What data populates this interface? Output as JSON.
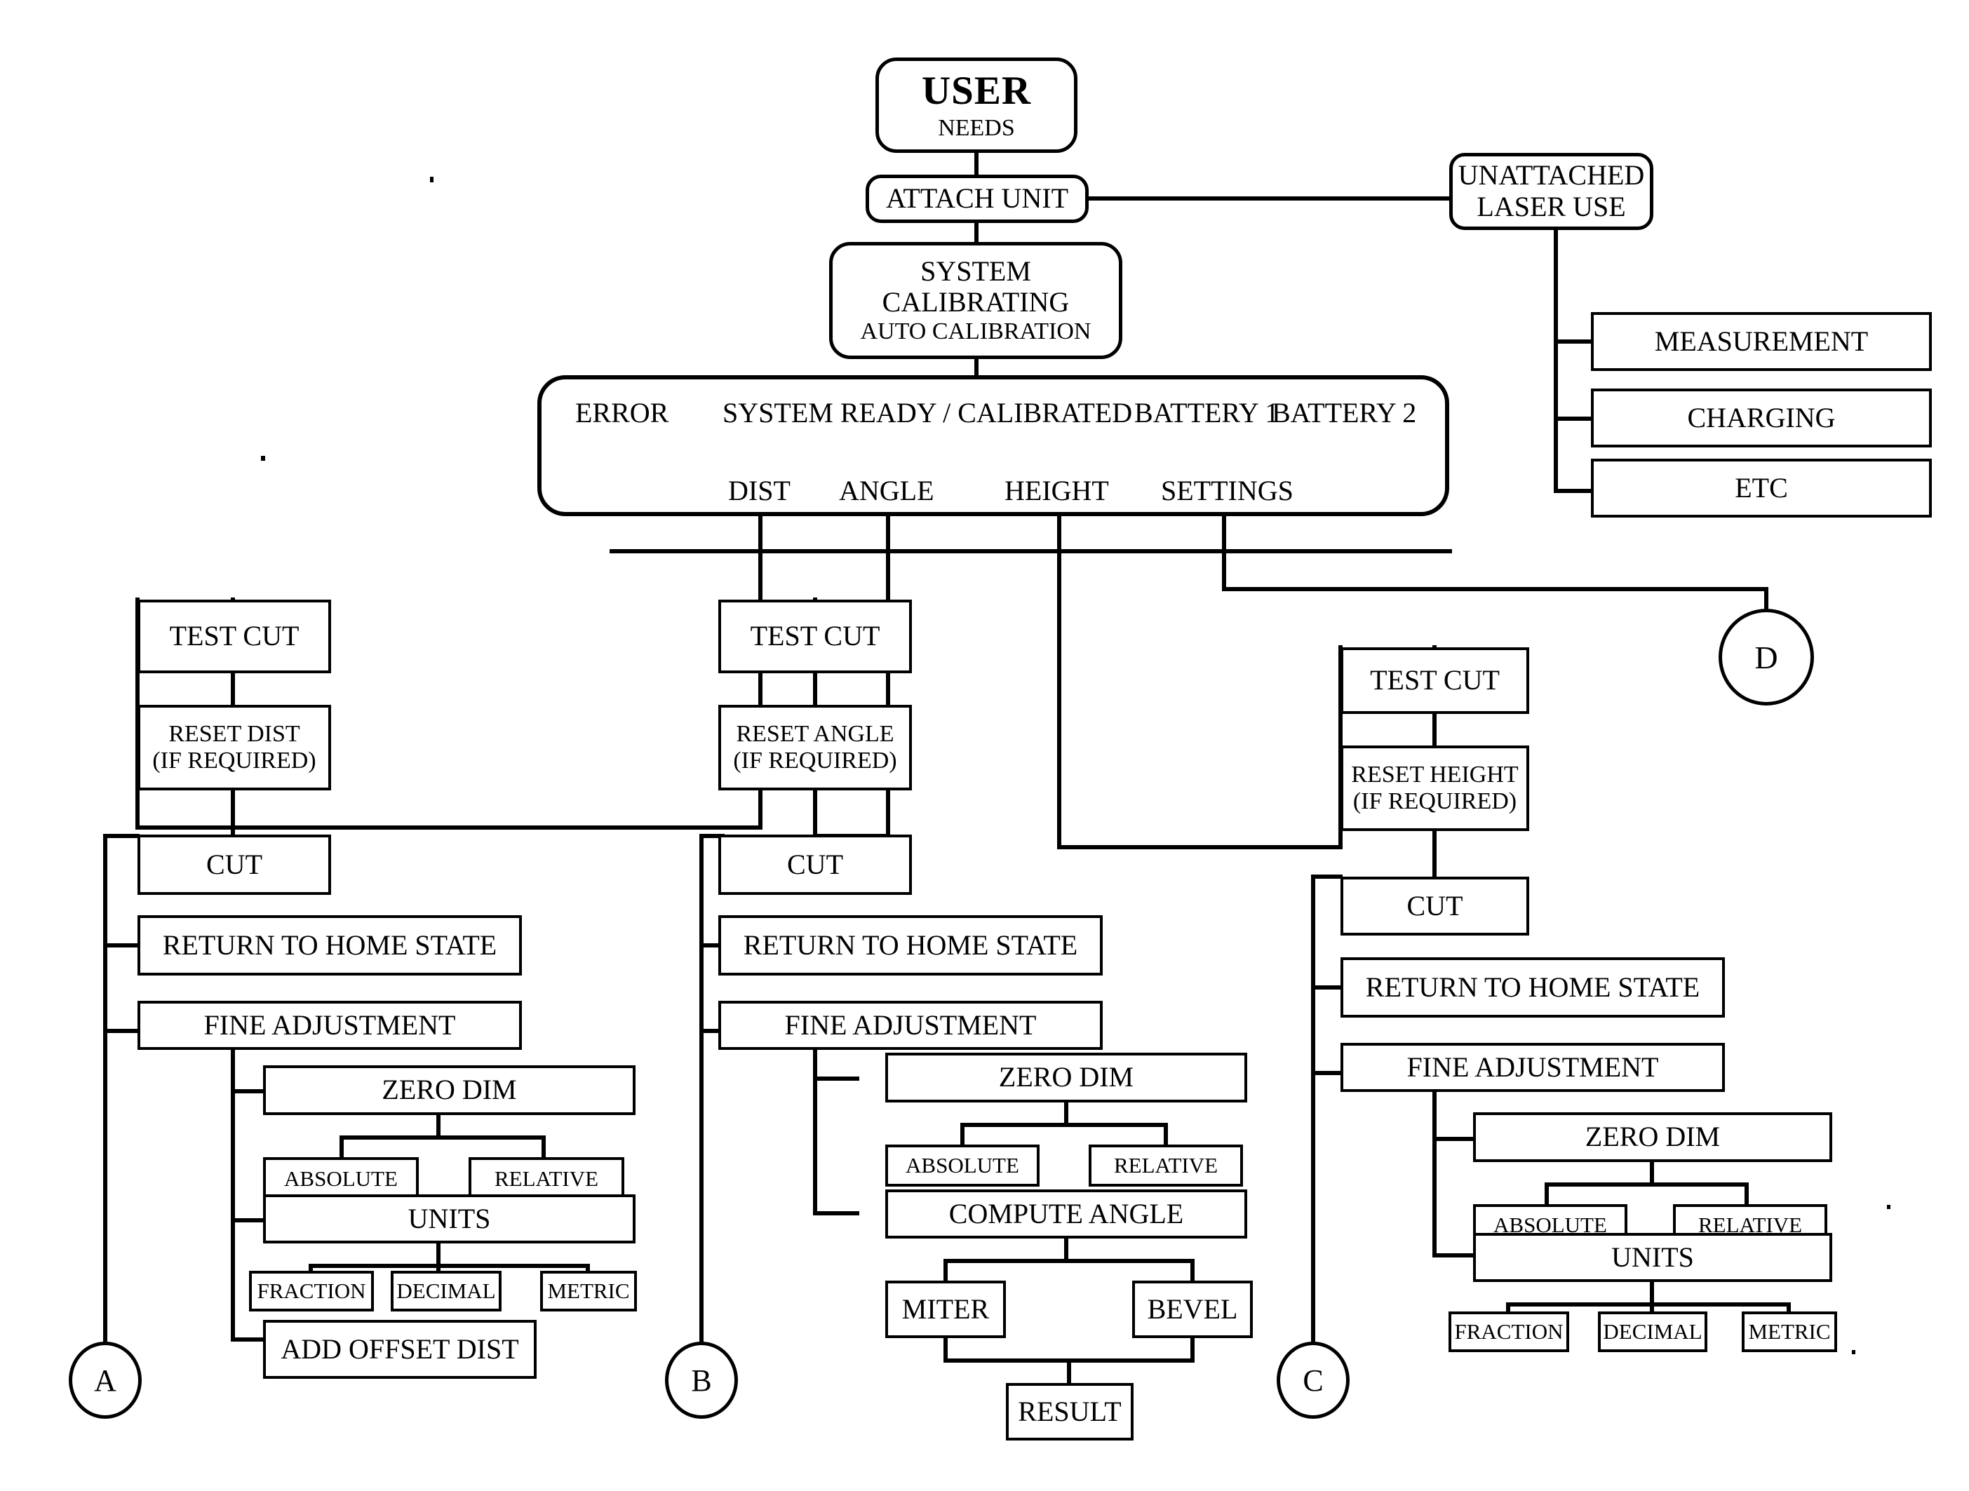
{
  "diagram": {
    "title_nodes": {
      "user": {
        "line1": "USER",
        "line2": "NEEDS"
      },
      "attach_unit": "ATTACH UNIT",
      "system_calibrating": {
        "line1": "SYSTEM",
        "line2": "CALIBRATING",
        "line3": "AUTO CALIBRATION"
      },
      "unattached_laser_use": {
        "line1": "UNATTACHED",
        "line2": "LASER USE"
      }
    },
    "status_panel": {
      "error": "ERROR",
      "system_ready": "SYSTEM READY / CALIBRATED",
      "battery1": "BATTERY 1",
      "battery2": "BATTERY 2",
      "menu": {
        "dist": "DIST",
        "angle": "ANGLE",
        "height": "HEIGHT",
        "settings": "SETTINGS"
      }
    },
    "laser_options": [
      {
        "label": "MEASUREMENT"
      },
      {
        "label": "CHARGING"
      },
      {
        "label": "ETC"
      }
    ],
    "dist_branch": {
      "test_cut": "TEST CUT",
      "reset": {
        "line1": "RESET DIST",
        "line2": "(IF REQUIRED)"
      },
      "cut": "CUT",
      "return_home": "RETURN TO HOME STATE",
      "fine_adjustment": "FINE ADJUSTMENT",
      "zero_dim": "ZERO DIM",
      "absolute": "ABSOLUTE",
      "relative": "RELATIVE",
      "units": "UNITS",
      "fraction": "FRACTION",
      "decimal": "DECIMAL",
      "metric": "METRIC",
      "add_offset": "ADD OFFSET DIST",
      "connector": "A"
    },
    "angle_branch": {
      "test_cut": "TEST CUT",
      "reset": {
        "line1": "RESET ANGLE",
        "line2": "(IF REQUIRED)"
      },
      "cut": "CUT",
      "return_home": "RETURN TO HOME STATE",
      "fine_adjustment": "FINE ADJUSTMENT",
      "zero_dim": "ZERO DIM",
      "absolute": "ABSOLUTE",
      "relative": "RELATIVE",
      "compute_angle": "COMPUTE ANGLE",
      "miter": "MITER",
      "bevel": "BEVEL",
      "result": "RESULT",
      "connector": "B"
    },
    "height_branch": {
      "test_cut": "TEST CUT",
      "reset": {
        "line1": "RESET HEIGHT",
        "line2": "(IF REQUIRED)"
      },
      "cut": "CUT",
      "return_home": "RETURN TO HOME STATE",
      "fine_adjustment": "FINE ADJUSTMENT",
      "zero_dim": "ZERO DIM",
      "absolute": "ABSOLUTE",
      "relative": "RELATIVE",
      "units": "UNITS",
      "fraction": "FRACTION",
      "decimal": "DECIMAL",
      "metric": "METRIC",
      "connector": "C"
    },
    "settings_branch": {
      "connector": "D"
    },
    "colors": {
      "ink": "#000000",
      "paper": "#ffffff"
    }
  }
}
